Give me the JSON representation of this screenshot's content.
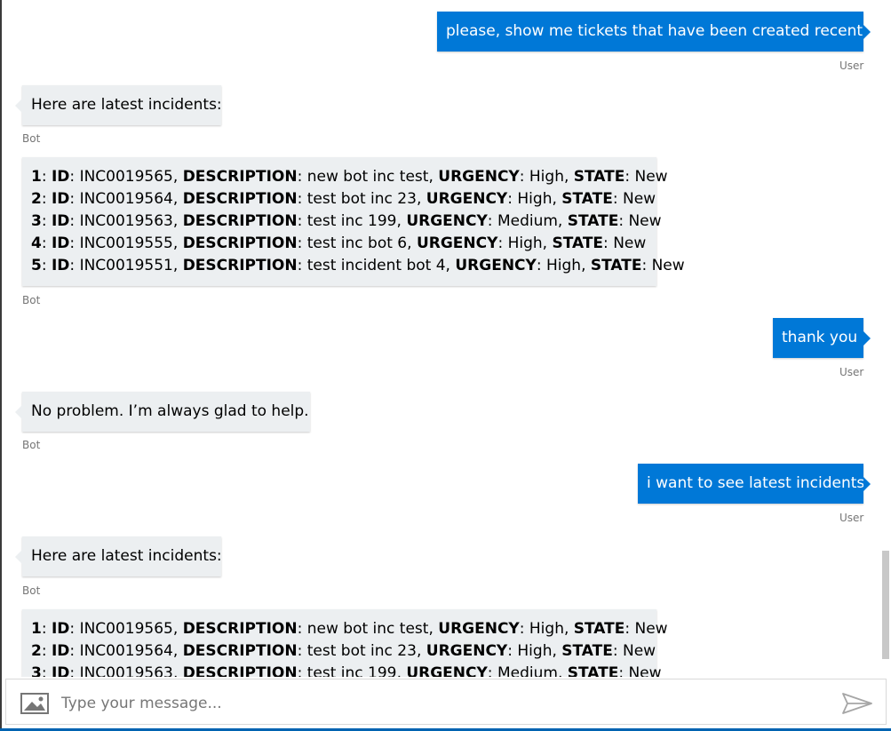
{
  "messages": {
    "m1": {
      "text": "please, show me tickets that have been created recently",
      "sender": "User"
    },
    "m2": {
      "text": "Here are latest incidents:",
      "sender": "Bot"
    },
    "m3": {
      "sender": "Bot",
      "rows": [
        {
          "num": "1",
          "id": "INC0019565",
          "description": "new bot inc test",
          "urgency": "High",
          "state": "New"
        },
        {
          "num": "2",
          "id": "INC0019564",
          "description": "test bot inc 23",
          "urgency": "High",
          "state": "New"
        },
        {
          "num": "3",
          "id": "INC0019563",
          "description": "test inc 199",
          "urgency": "Medium",
          "state": "New"
        },
        {
          "num": "4",
          "id": "INC0019555",
          "description": "test inc bot 6",
          "urgency": "High",
          "state": "New"
        },
        {
          "num": "5",
          "id": "INC0019551",
          "description": "test incident bot 4",
          "urgency": "High",
          "state": "New"
        }
      ]
    },
    "m4": {
      "text": "thank you",
      "sender": "User"
    },
    "m5": {
      "text": "No problem. I’m always glad to help.",
      "sender": "Bot"
    },
    "m6": {
      "text": "i want to see latest incidents",
      "sender": "User"
    },
    "m7": {
      "text": "Here are latest incidents:",
      "sender": "Bot"
    },
    "m8": {
      "rows": [
        {
          "num": "1",
          "id": "INC0019565",
          "description": "new bot inc test",
          "urgency": "High",
          "state": "New"
        },
        {
          "num": "2",
          "id": "INC0019564",
          "description": "test bot inc 23",
          "urgency": "High",
          "state": "New"
        },
        {
          "num": "3",
          "id": "INC0019563",
          "description": "test inc 199",
          "urgency": "Medium",
          "state": "New"
        }
      ]
    }
  },
  "labels": {
    "id": "ID",
    "description": "DESCRIPTION",
    "urgency": "URGENCY",
    "state": "STATE"
  },
  "composer": {
    "placeholder": "Type your message..."
  },
  "icons": {
    "attach": "image-icon",
    "send": "send-icon"
  },
  "colors": {
    "user_bubble": "#0078d7",
    "bot_bubble": "#eceff1",
    "accent_bar": "#0063b1"
  }
}
